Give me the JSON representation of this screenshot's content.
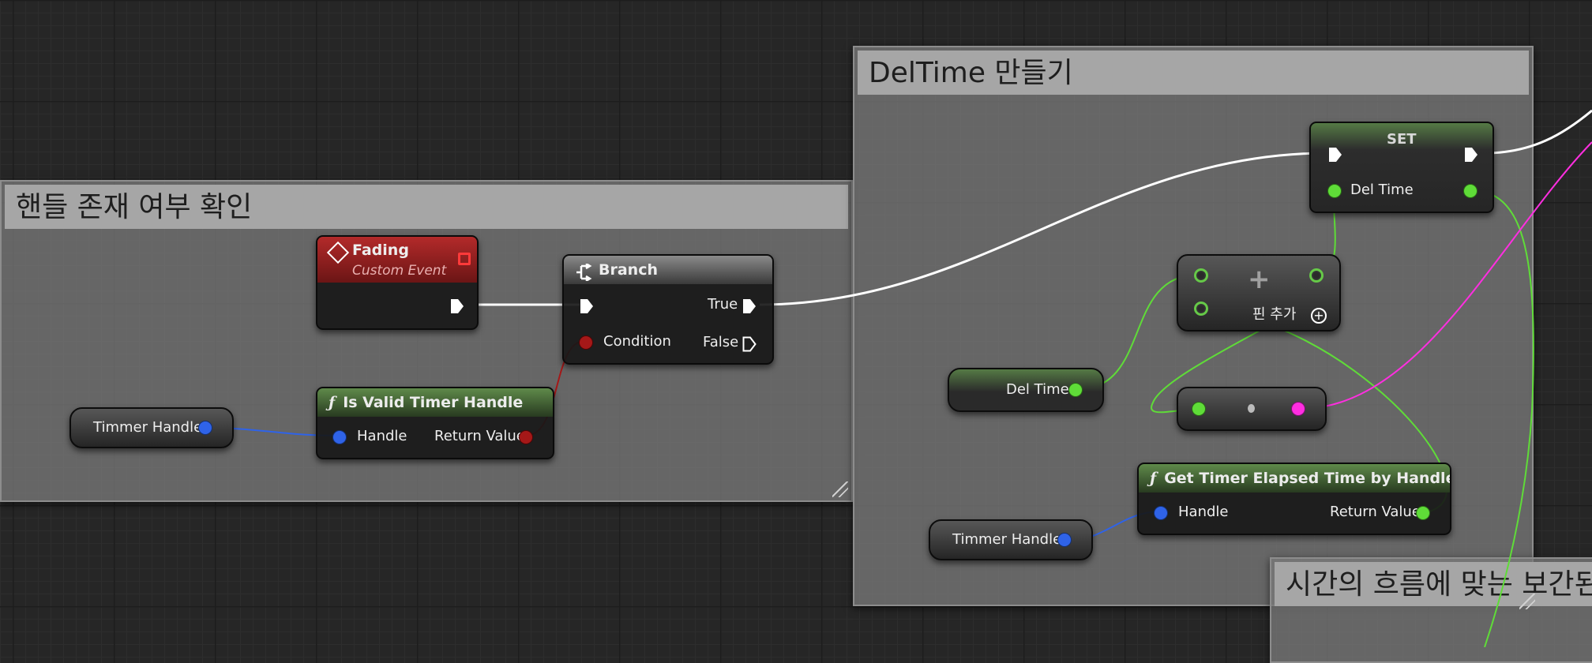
{
  "comments": {
    "handle_check": "핸들 존재 여부 확인",
    "deltime": "DelTime 만들기",
    "lerp": "시간의 흐름에 맞는 보간된"
  },
  "fading": {
    "title": "Fading",
    "subtitle": "Custom Event"
  },
  "branch": {
    "title": "Branch",
    "condition": "Condition",
    "true_label": "True",
    "false_label": "False"
  },
  "is_valid": {
    "title": "Is Valid Timer Handle",
    "handle": "Handle",
    "return_value": "Return Value"
  },
  "timer_handle_var_1": "Timmer Handle",
  "timer_handle_var_2": "Timmer Handle",
  "set_node": {
    "title": "SET",
    "var": "Del Time"
  },
  "deltime_var": "Del Time",
  "add_node": {
    "add_pin": "핀 추가",
    "icon": "plus-icon"
  },
  "get_elapsed": {
    "title": "Get Timer Elapsed Time by Handle",
    "handle": "Handle",
    "return_value": "Return Value"
  },
  "colors": {
    "exec": "#ffffff",
    "float": "#5fdc38",
    "struct": "#2f63e8",
    "bool": "#a51818",
    "vector": "#ff2ee0"
  }
}
